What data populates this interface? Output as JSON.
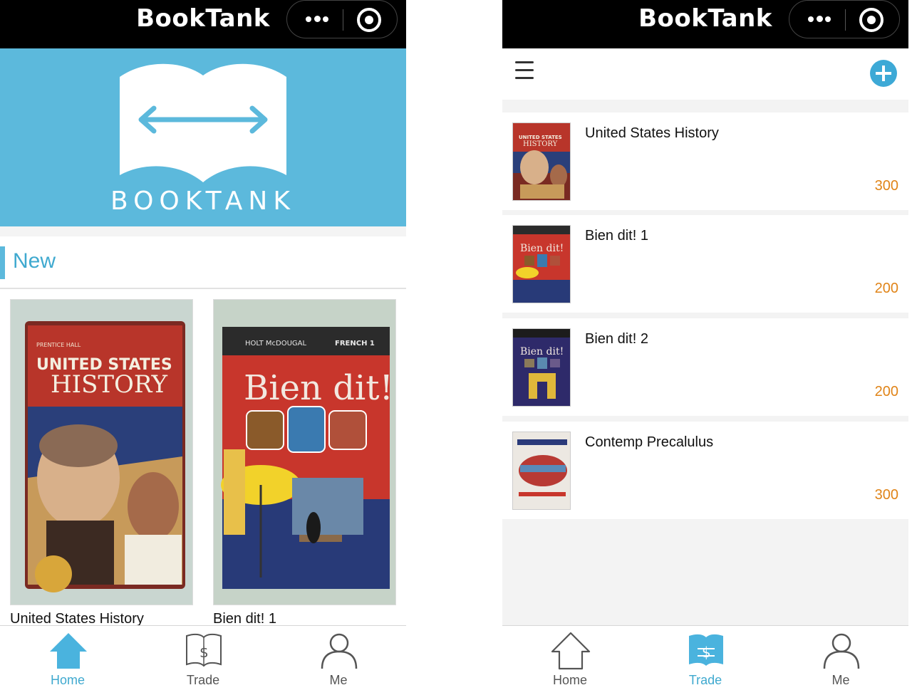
{
  "app_title": "BookTank",
  "brand_color": "#5cb9dc",
  "accent_color": "#3fa9cf",
  "price_color": "#e08418",
  "home": {
    "hero": {
      "logo_word": "BOOKTANK",
      "logo_icon": "open-book-double-arrow-icon"
    },
    "section_title": "New",
    "books": [
      {
        "title": "United States History",
        "cover_icon": "united-states-history-cover"
      },
      {
        "title": "Bien dit! 1",
        "cover_icon": "bien-dit-1-cover"
      }
    ]
  },
  "trade": {
    "menu_icon": "hamburger-menu-icon",
    "add_icon": "plus-circle-icon",
    "listings": [
      {
        "title": "United States History",
        "price": "300"
      },
      {
        "title": "Bien dit! 1",
        "price": "200"
      },
      {
        "title": "Bien dit! 2",
        "price": "200"
      },
      {
        "title": "Contemp Precalulus",
        "price": "300"
      }
    ]
  },
  "tabs": [
    {
      "label": "Home",
      "icon": "home-icon"
    },
    {
      "label": "Trade",
      "icon": "trade-book-dollar-icon"
    },
    {
      "label": "Me",
      "icon": "person-icon"
    }
  ],
  "home_active_tab": "Home",
  "trade_active_tab": "Trade"
}
